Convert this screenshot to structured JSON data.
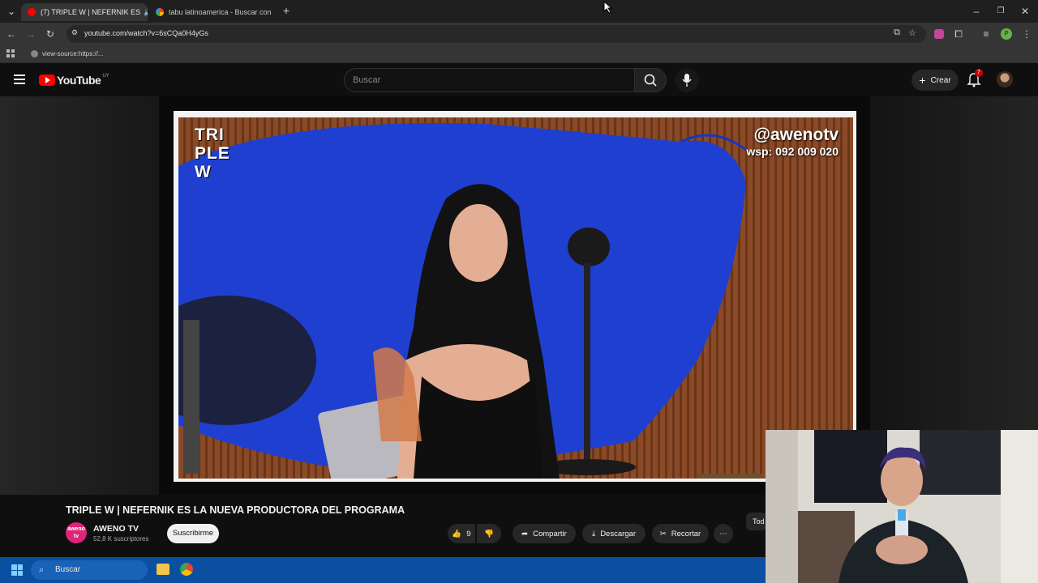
{
  "browser": {
    "tabs": [
      {
        "title": "(7) TRIPLE W | NEFERNIK ES",
        "active": true
      },
      {
        "title": "tabu latinoamerica - Buscar con",
        "active": false
      }
    ],
    "url": "youtube.com/watch?v=6sCQa0H4yGs",
    "bookmark": "view-source:https://..."
  },
  "youtube": {
    "logo_text": "YouTube",
    "region": "UY",
    "search_placeholder": "Buscar",
    "create_label": "Crear",
    "notifications": "7"
  },
  "video": {
    "overlay_logo": "TRI\nPLE\nW",
    "handle": "@awenotv",
    "whatsapp": "wsp: 092 009 020"
  },
  "watch": {
    "title": "TRIPLE W | NEFERNIK ES LA NUEVA PRODUCTORA DEL PROGRAMA",
    "channel_avatar": "aweno\ntv",
    "channel_name": "AWENO TV",
    "subscribers": "52,8 K suscriptores",
    "subscribe_label": "Suscribirme",
    "likes": "9",
    "share_label": "Compartir",
    "download_label": "Descargar",
    "clip_label": "Recortar",
    "chip_label": "Tod"
  },
  "taskbar": {
    "search_label": "Buscar"
  },
  "colors": {
    "youtube_red": "#ff0000",
    "blue_set": "#1f3fd0",
    "taskbar": "#0a4fa0"
  }
}
